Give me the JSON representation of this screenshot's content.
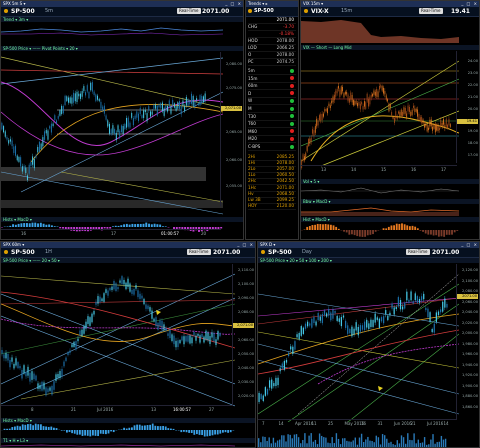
{
  "panes": {
    "tl": {
      "title": "SPX 5m S ▾",
      "symbol": "SP-500",
      "timeframe": "5m",
      "price": "2071.00",
      "rt_button": "Real-Time",
      "legend": "SP-500 Price ▾  ——  Pivot Points ▾  20 ▾",
      "top_ind": "Trend ▾  3m ▾",
      "sub_ind": "Hists ▾  MacD ▾",
      "yticks": [
        "2,080.00",
        "2,075.00",
        "2,071.00",
        "2,065.00",
        "2,060.00",
        "2,055.00"
      ],
      "xticks": [
        "16",
        "17",
        "20"
      ],
      "price_tag": "2,071.00",
      "date_tag": "01:00:57"
    },
    "wl": {
      "title": "Trends ▾ ▸",
      "symbol": "SP-500",
      "price": "2071.00",
      "rows": [
        {
          "n": "CHG",
          "v": "-3.70",
          "c": "#ff3b3b"
        },
        {
          "n": "",
          "v": "-0.18%",
          "c": "#ff3b3b"
        },
        {
          "n": "HOD",
          "v": "2078.00",
          "c": "#cccccc"
        },
        {
          "n": "LOD",
          "v": "2066.25",
          "c": "#cccccc"
        },
        {
          "n": "O",
          "v": "2078.00",
          "c": "#cccccc"
        },
        {
          "n": "PC",
          "v": "2074.75",
          "c": "#cccccc"
        }
      ],
      "trend_rows": [
        {
          "n": "5m",
          "d": "#1fbf3a"
        },
        {
          "n": "15m",
          "d": "#e01e1e"
        },
        {
          "n": "60m",
          "d": "#e01e1e"
        },
        {
          "n": "D",
          "d": "#e01e1e"
        },
        {
          "n": "W",
          "d": "#1fbf3a"
        },
        {
          "n": "M",
          "d": "#1fbf3a"
        },
        {
          "n": "T30",
          "d": "#1fbf3a"
        },
        {
          "n": "T60",
          "d": "#1fbf3a"
        },
        {
          "n": "M60",
          "d": "#e01e1e"
        },
        {
          "n": "M20",
          "d": "#e01e1e"
        },
        {
          "n": "C-BPS",
          "d": "#1fbf3a"
        }
      ],
      "levels": [
        {
          "n": "2Hi",
          "v": "2085.25"
        },
        {
          "n": "1Hi",
          "v": "2078.00"
        },
        {
          "n": "2Lo",
          "v": "2057.00"
        },
        {
          "n": "1Lo",
          "v": "2060.50"
        },
        {
          "n": "2Hc",
          "v": "2042.50"
        },
        {
          "n": "1Hc",
          "v": "2071.00"
        },
        {
          "n": "Hv",
          "v": "2068.50"
        },
        {
          "n": "Lw 3B",
          "v": "2099.25"
        },
        {
          "n": "HOY",
          "v": "2120.00"
        }
      ]
    },
    "tr": {
      "title": "VIX 15m ▾",
      "symbol": "VIX-X",
      "timeframe": "15m",
      "price": "19.41",
      "rt_button": "Real-Time",
      "legend": "VIX  —  Short  —  Long Mid",
      "yticks": [
        "24.00",
        "23.00",
        "22.00",
        "21.00",
        "20.00",
        "19.41",
        "19.00",
        "18.00",
        "17.00",
        "16.00"
      ],
      "xticks": [
        "13",
        "14",
        "15",
        "16",
        "17"
      ],
      "sub1": "Vol ▾  5 ▾",
      "sub2": "Bbw ▾  MacD ▾",
      "sub3": "Hist ▾  MacD ▾"
    },
    "bl": {
      "title": "SPX 60m ▾",
      "symbol": "SP-500",
      "timeframe": "1H",
      "price": "2071.00",
      "rt_button": "Real-Time",
      "legend": "SP-500 Price ▾  ——  20 ▾  50 ▾",
      "yticks": [
        "2,110.00",
        "2,100.00",
        "2,090.00",
        "2,080.00",
        "2,071.00",
        "2,060.00",
        "2,050.00",
        "2,040.00",
        "2,030.00",
        "2,020.00"
      ],
      "xticks": [
        "8",
        "21",
        "Jul 2016",
        "13",
        "27"
      ],
      "sub_ind": "Hists ▾  MacD ▾",
      "date_tag": "16:00:57",
      "sub3": "T1 ▾  H ▾  L3 ▾"
    },
    "br": {
      "title": "SPX D ▾",
      "symbol": "SP-500",
      "timeframe": "Day",
      "price": "2071.00",
      "rt_button": "Real-Time",
      "legend": "SP-500 Price ▾  20 ▾  50 ▾  100 ▾  200 ▾",
      "yticks": [
        "2,120.00",
        "2,100.00",
        "2,080.00",
        "2,060.00",
        "2,040.00",
        "2,020.00",
        "2,000.00",
        "1,980.00",
        "1,960.00",
        "1,940.00",
        "1,920.00",
        "1,900.00",
        "1,880.00",
        "1,860.00"
      ],
      "xticks": [
        "7",
        "14",
        "Apr 2016",
        "11",
        "25",
        "May 2016",
        "16",
        "31",
        "Jun 2016",
        "21",
        "Jul 2016",
        "14"
      ],
      "date_tag": "16:00:57"
    }
  },
  "colors": {
    "title_bar": "#1e2f55",
    "toolbar": "#06101f",
    "candle_up": "#45c8e6",
    "candle_dn": "#1a6fa8",
    "price_tag": "#d8c040"
  }
}
